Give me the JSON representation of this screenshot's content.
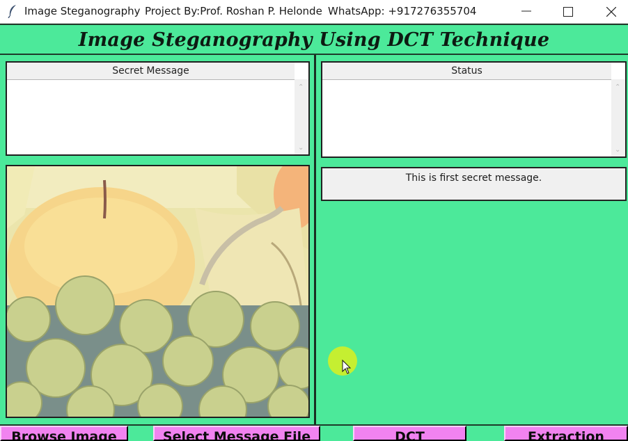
{
  "window": {
    "app_title": "Image Steganography",
    "project_by": "Project By:Prof. Roshan P. Helonde",
    "whatsapp": "WhatsApp: +917276355704"
  },
  "header": {
    "title": "Image Steganography Using DCT Technique"
  },
  "secret_message_panel": {
    "label": "Secret Message",
    "value": ""
  },
  "status_panel": {
    "label": "Status",
    "value": ""
  },
  "message_display": {
    "text": "This is first secret message."
  },
  "buttons": {
    "browse": "Browse Image",
    "select_message": "Select Message File",
    "dct": "DCT",
    "extraction": "Extraction"
  },
  "colors": {
    "background": "#4ce99a",
    "button": "#f183f0"
  },
  "icons": [
    "feather-icon",
    "minimize-icon",
    "maximize-icon",
    "close-icon",
    "mouse-pointer-icon"
  ]
}
